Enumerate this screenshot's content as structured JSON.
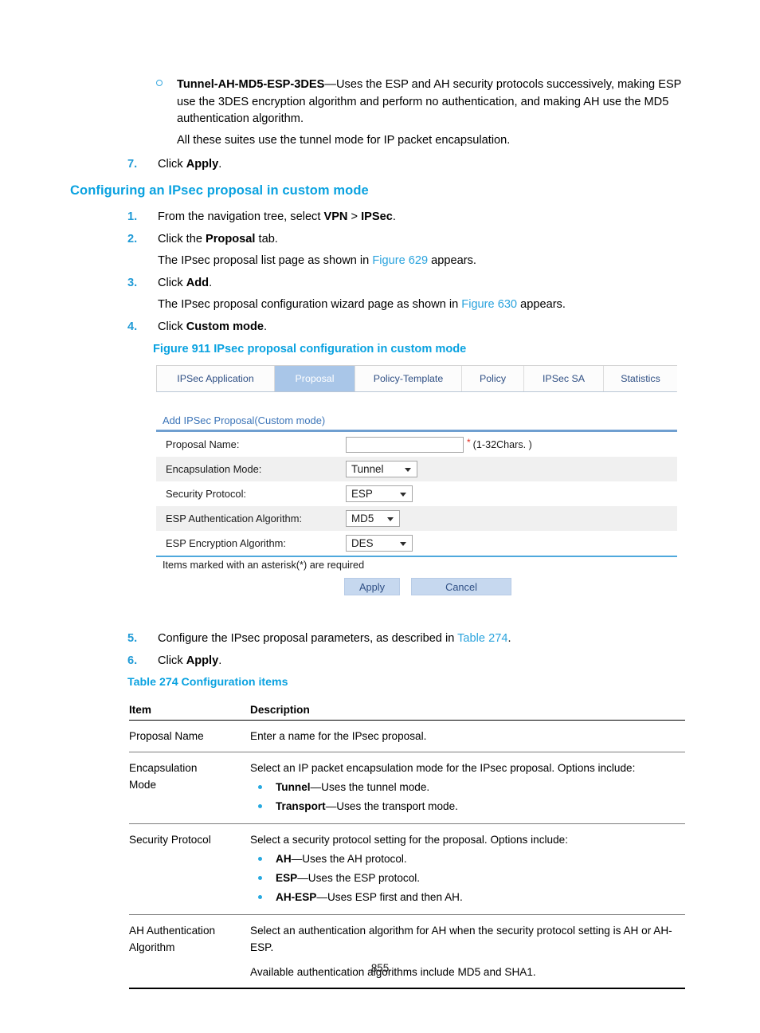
{
  "document": {
    "page_number": "855",
    "top_bullet": {
      "term": "Tunnel-AH-MD5-ESP-3DES",
      "description": "—Uses the ESP and AH security protocols successively, making ESP use the 3DES encryption algorithm and perform no authentication, and making AH use the MD5 authentication algorithm."
    },
    "all_suites_note": "All these suites use the tunnel mode for IP packet encapsulation.",
    "step7": {
      "number": "7.",
      "text_before": "Click ",
      "bold": "Apply",
      "text_after": "."
    },
    "section_heading": "Configuring an IPsec proposal in custom mode",
    "steps": [
      {
        "number": "1.",
        "text_before": "From the navigation tree, select ",
        "bold1": "VPN",
        "mid": " > ",
        "bold2": "IPSec",
        "text_after": "."
      },
      {
        "number": "2.",
        "text_before": "Click the ",
        "bold1": "Proposal",
        "text_after": " tab."
      },
      {
        "number": "3.",
        "text_before": "Click ",
        "bold1": "Add",
        "text_after": "."
      },
      {
        "number": "4.",
        "text_before": "Click ",
        "bold1": "Custom mode",
        "text_after": "."
      }
    ],
    "sub_paragraphs": [
      {
        "before": "The IPsec proposal list page as shown in ",
        "link": "Figure 629",
        "after": " appears."
      },
      {
        "before": "The IPsec proposal configuration wizard page as shown in ",
        "link": "Figure 630",
        "after": " appears."
      }
    ],
    "step5": {
      "number": "5.",
      "before": "Configure the IPsec proposal parameters, as described in ",
      "link": "Table 274",
      "after": "."
    },
    "step6": {
      "number": "6.",
      "before": "Click ",
      "bold": "Apply",
      "after": "."
    },
    "figure_caption": "Figure 911 IPsec proposal configuration in custom mode",
    "table_caption": "Table 274 Configuration items"
  },
  "ui": {
    "tabs": [
      {
        "label": "IPSec Application",
        "active": false
      },
      {
        "label": "Proposal",
        "active": true
      },
      {
        "label": "Policy-Template",
        "active": false
      },
      {
        "label": "Policy",
        "active": false
      },
      {
        "label": "IPSec SA",
        "active": false
      },
      {
        "label": "Statistics",
        "active": false
      }
    ],
    "panel_title": "Add IPSec Proposal(Custom mode)",
    "fields": [
      {
        "label": "Proposal Name:",
        "type": "text",
        "value": "",
        "required_mark": "*",
        "hint": "(1-32Chars. )"
      },
      {
        "label": "Encapsulation Mode:",
        "type": "select",
        "value": "Tunnel"
      },
      {
        "label": "Security Protocol:",
        "type": "select",
        "value": "ESP"
      },
      {
        "label": "ESP Authentication Algorithm:",
        "type": "select",
        "value": "MD5"
      },
      {
        "label": "ESP Encryption Algorithm:",
        "type": "select",
        "value": "DES"
      }
    ],
    "footer_note": "Items marked with an asterisk(*) are required",
    "buttons": {
      "apply": "Apply",
      "cancel": "Cancel"
    },
    "colors": {
      "active_tab_bg": "#a9c6e8",
      "tab_text": "#2f4f84",
      "panel_title": "#3b74b8",
      "button_bg": "#c6d8ef",
      "required_star": "#e02b20"
    }
  },
  "table": {
    "headers": {
      "item": "Item",
      "description": "Description"
    },
    "rows": [
      {
        "item": "Proposal Name",
        "intro": "Enter a name for the IPsec proposal.",
        "options": [],
        "extra": ""
      },
      {
        "item_line1": "Encapsulation",
        "item_line2": "Mode",
        "intro": "Select an IP packet encapsulation mode for the IPsec proposal. Options include:",
        "options": [
          {
            "term": "Tunnel",
            "desc": "—Uses the tunnel mode."
          },
          {
            "term": "Transport",
            "desc": "—Uses the transport mode."
          }
        ],
        "extra": ""
      },
      {
        "item": "Security Protocol",
        "intro": "Select a security protocol setting for the proposal. Options include:",
        "options": [
          {
            "term": "AH",
            "desc": "—Uses the AH protocol."
          },
          {
            "term": "ESP",
            "desc": "—Uses the ESP protocol."
          },
          {
            "term": "AH-ESP",
            "desc": "—Uses ESP first and then AH."
          }
        ],
        "extra": ""
      },
      {
        "item_line1": "AH Authentication",
        "item_line2": "Algorithm",
        "intro": "Select an authentication algorithm for AH when the security protocol setting is AH or AH-ESP.",
        "options": [],
        "extra": "Available authentication algorithms include MD5 and SHA1."
      }
    ]
  }
}
